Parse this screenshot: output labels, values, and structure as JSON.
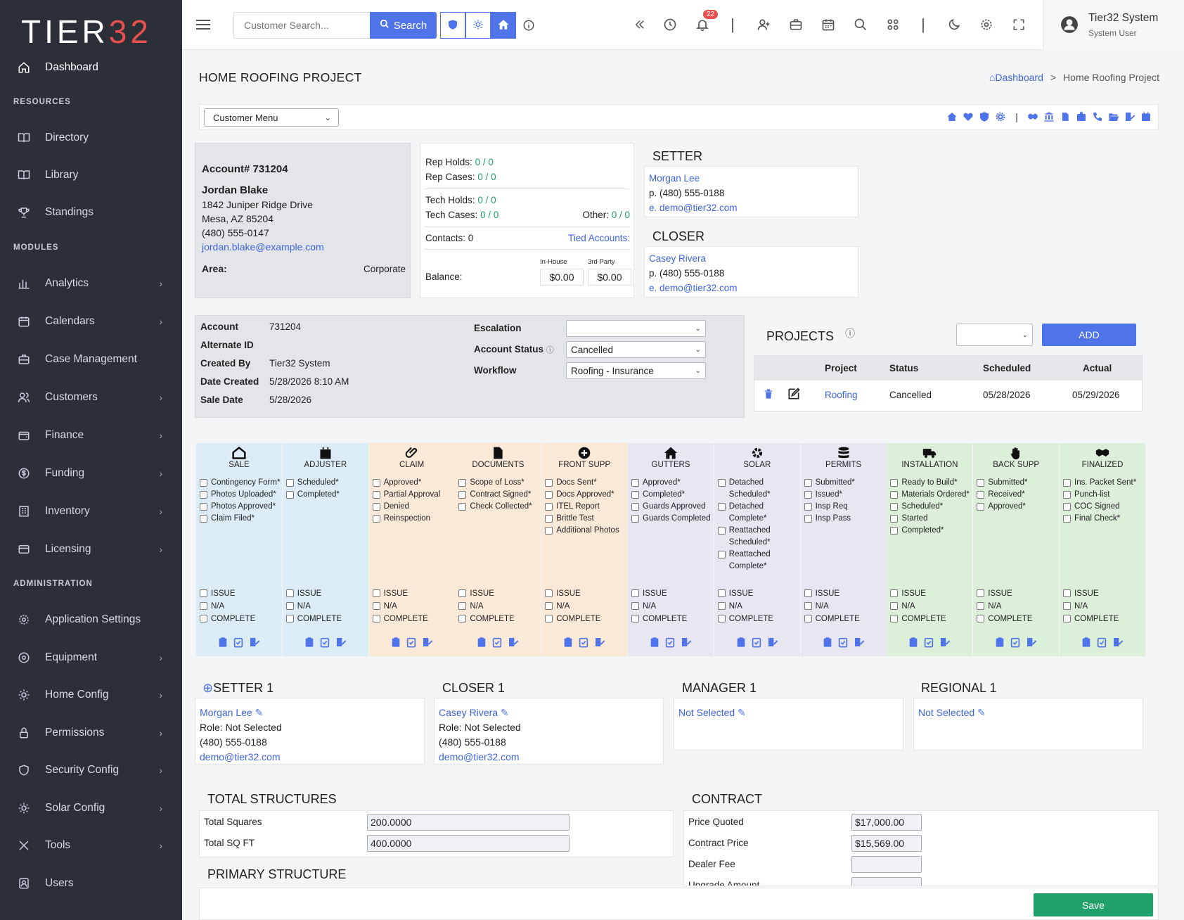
{
  "app": {
    "logo_left": "TIER",
    "logo_right": "32",
    "user_name": "Tier32 System",
    "user_role": "System User",
    "notif_count": "22"
  },
  "colors": {
    "primary": "#4f73e8",
    "sidebar": "#2b2f38",
    "success": "#22a06b",
    "logo_accent": "#e94f4f"
  },
  "sidebar": {
    "dashboard": "Dashboard",
    "resources_head": "RESOURCES",
    "resources": [
      "Directory",
      "Library",
      "Standings"
    ],
    "modules_head": "MODULES",
    "modules": [
      "Analytics",
      "Calendars",
      "Case Management",
      "Customers",
      "Finance",
      "Funding",
      "Inventory",
      "Licensing"
    ],
    "admin_head": "ADMINISTRATION",
    "admin": [
      "Application Settings",
      "Equipment",
      "Home Config",
      "Permissions",
      "Security Config",
      "Solar Config",
      "Tools",
      "Users"
    ]
  },
  "topbar": {
    "search_placeholder": "Customer Search...",
    "search_label": "Search"
  },
  "page": {
    "title": "HOME ROOFING PROJECT",
    "breadcrumb_home": "Dashboard",
    "breadcrumb_sep": ">",
    "breadcrumb_current": "Home Roofing Project",
    "customer_menu": "Customer Menu"
  },
  "account": {
    "number_label": "Account# 731204",
    "name": "Jordan Blake",
    "address1": "1842 Juniper Ridge Drive",
    "address2": "Mesa, AZ 85204",
    "phone": "(480) 555-0147",
    "email": "jordan.blake@example.com",
    "area_label": "Area:",
    "area_value": "Corporate"
  },
  "stats": {
    "rep_holds_label": "Rep Holds:",
    "rep_holds": "0 / 0",
    "rep_cases_label": "Rep Cases:",
    "rep_cases": "0 / 0",
    "tech_holds_label": "Tech Holds:",
    "tech_holds": "0 / 0",
    "tech_cases_label": "Tech Cases:",
    "tech_cases": "0 / 0",
    "other_label": "Other:",
    "other": "0 / 0",
    "contacts_label": "Contacts:",
    "contacts": "0",
    "tied_accounts": "Tied Accounts:",
    "inhouse_label": "In-House",
    "thirdparty_label": "3rd Party",
    "balance_label": "Balance:",
    "inhouse_balance": "$0.00",
    "thirdparty_balance": "$0.00"
  },
  "setter": {
    "title": "SETTER",
    "name": "Morgan Lee",
    "phone": "p. (480) 555-0188",
    "email": "e. demo@tier32.com"
  },
  "closer": {
    "title": "CLOSER",
    "name": "Casey Rivera",
    "phone": "p. (480) 555-0188",
    "email": "e. demo@tier32.com"
  },
  "details": {
    "account_label": "Account",
    "account": "731204",
    "alt_id_label": "Alternate ID",
    "alt_id": "",
    "created_by_label": "Created By",
    "created_by": "Tier32 System",
    "date_created_label": "Date Created",
    "date_created": "5/28/2026 8:10 AM",
    "sale_date_label": "Sale Date",
    "sale_date": "5/28/2026",
    "escalation_label": "Escalation",
    "escalation": "",
    "status_label": "Account Status",
    "status": "Cancelled",
    "workflow_label": "Workflow",
    "workflow": "Roofing - Insurance"
  },
  "projects": {
    "title": "PROJECTS",
    "add_label": "ADD",
    "columns": [
      "Project",
      "Status",
      "Scheduled",
      "Actual"
    ],
    "rows": [
      {
        "project": "Roofing",
        "status": "Cancelled",
        "scheduled": "05/28/2026",
        "actual": "05/29/2026"
      }
    ]
  },
  "stages": [
    {
      "name": "SALE",
      "icon": "house-icon",
      "items": [
        "Contingency Form*",
        "Photos Uploaded*",
        "Photos Approved*",
        "Claim Filed*"
      ]
    },
    {
      "name": "ADJUSTER",
      "icon": "calendar-icon",
      "items": [
        "Scheduled*",
        "Completed*"
      ]
    },
    {
      "name": "CLAIM",
      "icon": "paperclip-icon",
      "items": [
        "Approved*",
        "Partial Approval",
        "Denied",
        "Reinspection"
      ]
    },
    {
      "name": "DOCUMENTS",
      "icon": "file-icon",
      "items": [
        "Scope of Loss*",
        "Contract Signed*",
        "Check Collected*"
      ]
    },
    {
      "name": "FRONT SUPP",
      "icon": "plus-circle-icon",
      "items": [
        "Docs Sent*",
        "Docs Approved*",
        "ITEL Report",
        "Brittle Test",
        "Additional Photos"
      ]
    },
    {
      "name": "GUTTERS",
      "icon": "home-icon",
      "items": [
        "Approved*",
        "Completed*",
        "Guards Approved",
        "Guards Completed"
      ]
    },
    {
      "name": "SOLAR",
      "icon": "gear-icon",
      "items": [
        "Detached Scheduled*",
        "Detached Complete*",
        "Reattached Scheduled*",
        "Reattached Complete*"
      ]
    },
    {
      "name": "PERMITS",
      "icon": "database-icon",
      "items": [
        "Submitted*",
        "Issued*",
        "Insp Req",
        "Insp Pass"
      ]
    },
    {
      "name": "INSTALLATION",
      "icon": "truck-icon",
      "items": [
        "Ready to Build*",
        "Materials Ordered*",
        "Scheduled*",
        "Started",
        "Completed*"
      ]
    },
    {
      "name": "BACK SUPP",
      "icon": "hand-icon",
      "items": [
        "Submitted*",
        "Received*",
        "Approved*"
      ]
    },
    {
      "name": "FINALIZED",
      "icon": "handshake-icon",
      "items": [
        "Ins. Packet Sent*",
        "Punch-list",
        "COC Signed",
        "Final Check*"
      ]
    }
  ],
  "stage_bottom": [
    "ISSUE",
    "N/A",
    "COMPLETE"
  ],
  "reps": [
    {
      "title": "SETTER 1",
      "name": "Morgan Lee",
      "role": "Role: Not Selected",
      "phone": "(480) 555-0188",
      "email": "demo@tier32.com"
    },
    {
      "title": "CLOSER 1",
      "name": "Casey Rivera",
      "role": "Role: Not Selected",
      "phone": "(480) 555-0188",
      "email": "demo@tier32.com"
    },
    {
      "title": "MANAGER 1",
      "name": "Not Selected"
    },
    {
      "title": "REGIONAL 1",
      "name": "Not Selected"
    }
  ],
  "structures": {
    "title": "TOTAL STRUCTURES",
    "squares_label": "Total Squares",
    "squares": "200.0000",
    "sqft_label": "Total SQ FT",
    "sqft": "400.0000",
    "primary_title": "PRIMARY STRUCTURE"
  },
  "contract": {
    "title": "CONTRACT",
    "price_quoted_label": "Price Quoted",
    "price_quoted": "$17,000.00",
    "contract_price_label": "Contract Price",
    "contract_price": "$15,569.00",
    "dealer_fee_label": "Dealer Fee",
    "dealer_fee": "",
    "upgrade_label": "Upgrade Amount",
    "upgrade": ""
  },
  "save_label": "Save"
}
